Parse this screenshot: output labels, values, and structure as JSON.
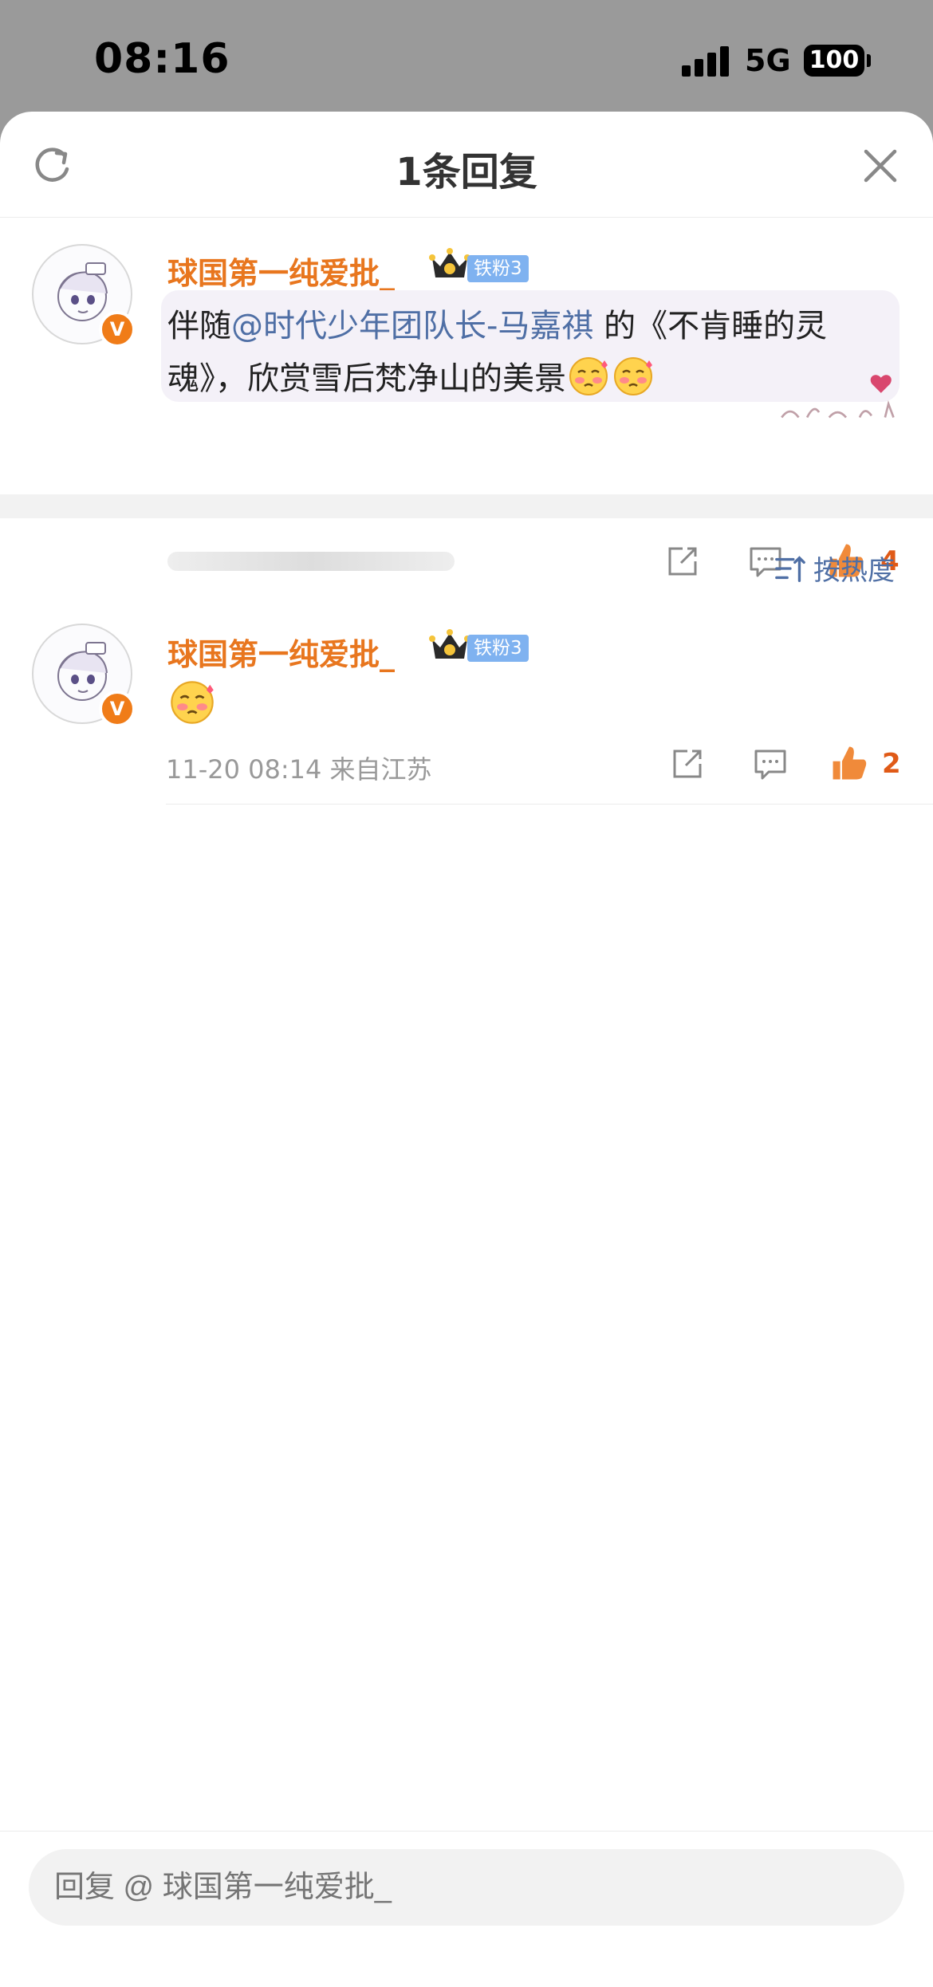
{
  "status_bar": {
    "time": "08:16",
    "network": "5G",
    "battery": "100"
  },
  "sheet": {
    "title": "1条回复"
  },
  "root_comment": {
    "username": "球国第一纯爱批_",
    "fan_badge": "铁粉3",
    "verified": "V",
    "text_before": "伴随",
    "mention": "@时代少年团队长-马嘉祺",
    "text_after": " 的《不肯睡的灵魂》，欣赏雪后梵净山的美景",
    "emojis": [
      "shy-blush-emoji",
      "shy-blush-emoji"
    ],
    "likes": "4"
  },
  "sort": {
    "label": "按热度"
  },
  "replies": [
    {
      "username": "球国第一纯爱批_",
      "fan_badge": "铁粉3",
      "verified": "V",
      "emoji": "shy-blush-emoji",
      "meta": "11-20 08:14 来自江苏",
      "likes": "2"
    }
  ],
  "reply_box": {
    "placeholder": "回复 @ 球国第一纯爱批_"
  },
  "colors": {
    "username": "#e8761e",
    "mention": "#4f6fa5",
    "like": "#e05a17",
    "fan_badge": "#7fb2f0"
  }
}
